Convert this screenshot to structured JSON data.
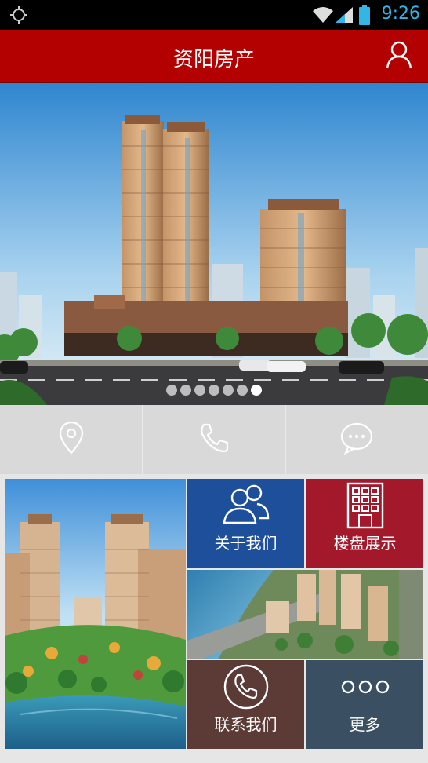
{
  "status_bar": {
    "time": "9:26",
    "icons": [
      "gps-icon",
      "wifi-icon",
      "signal-icon",
      "battery-icon"
    ]
  },
  "header": {
    "title": "资阳房产",
    "user_icon": "user-icon",
    "color": "#b30000"
  },
  "banner": {
    "slide_count": 7,
    "active_index": 6
  },
  "quick_actions": [
    {
      "icon": "location-icon"
    },
    {
      "icon": "phone-icon"
    },
    {
      "icon": "chat-icon"
    }
  ],
  "tiles": {
    "about": {
      "label": "关于我们",
      "icon": "people-icon",
      "color": "#1e4f9a"
    },
    "projects": {
      "label": "楼盘展示",
      "icon": "building-icon",
      "color": "#a3192b"
    },
    "contact": {
      "label": "联系我们",
      "icon": "phone-circle-icon",
      "color": "#5c3b37"
    },
    "more": {
      "label": "更多",
      "icon": "more-icon",
      "color": "#3a4f61"
    }
  }
}
